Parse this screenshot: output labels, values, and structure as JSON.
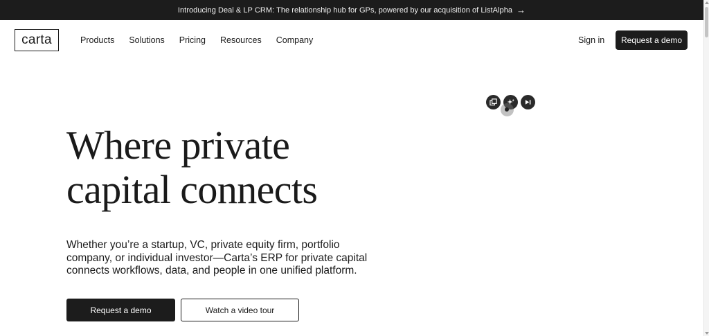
{
  "announcement": {
    "text": "Introducing Deal & LP CRM: The relationship hub for GPs, powered by our acquisition of ListAlpha",
    "arrow": "→"
  },
  "header": {
    "logo_text": "carta",
    "nav": [
      {
        "label": "Products"
      },
      {
        "label": "Solutions"
      },
      {
        "label": "Pricing"
      },
      {
        "label": "Resources"
      },
      {
        "label": "Company"
      }
    ],
    "sign_in": "Sign in",
    "request_demo": "Request a demo"
  },
  "floating_toolbar": {
    "icons": [
      "copy-icon",
      "sparkle-icon",
      "video-icon"
    ]
  },
  "hero": {
    "title_line1": "Where private",
    "title_line2": "capital connects",
    "subtitle": "Whether you’re a startup, VC, private equity firm, portfolio company, or individual investor—Carta’s ERP for private capital connects workflows, data, and people in one unified platform.",
    "primary_cta": "Request a demo",
    "secondary_cta": "Watch a video tour"
  },
  "colors": {
    "dark": "#1c1c1c",
    "background": "#ffffff",
    "text": "#1a1a1a"
  }
}
